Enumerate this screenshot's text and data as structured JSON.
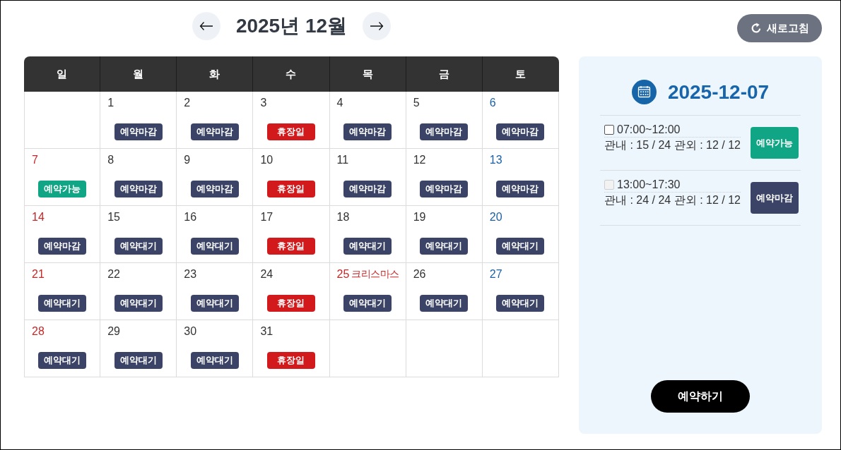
{
  "header": {
    "title": "2025년 12월",
    "refresh_button": "새로고침"
  },
  "calendar": {
    "weekdays": [
      "일",
      "월",
      "화",
      "수",
      "목",
      "금",
      "토"
    ],
    "weeks": [
      [
        {
          "day": "1",
          "kind": "weekday",
          "badge": {
            "label": "예약마감",
            "color": "#3b4466"
          }
        },
        {
          "day": "2",
          "kind": "weekday",
          "badge": {
            "label": "예약마감",
            "color": "#3b4466"
          }
        },
        {
          "day": "3",
          "kind": "weekday",
          "badge": {
            "label": "휴장일",
            "color": "#d2191c"
          }
        },
        {
          "day": "4",
          "kind": "weekday",
          "badge": {
            "label": "예약마감",
            "color": "#3b4466"
          }
        },
        {
          "day": "5",
          "kind": "weekday",
          "badge": {
            "label": "예약마감",
            "color": "#3b4466"
          }
        },
        {
          "day": "6",
          "kind": "saturday",
          "badge": {
            "label": "예약마감",
            "color": "#3b4466"
          }
        }
      ],
      [
        {
          "day": "7",
          "kind": "holiday",
          "badge": {
            "label": "예약가능",
            "color": "#10a584"
          }
        },
        {
          "day": "8",
          "kind": "weekday",
          "badge": {
            "label": "예약마감",
            "color": "#3b4466"
          }
        },
        {
          "day": "9",
          "kind": "weekday",
          "badge": {
            "label": "예약마감",
            "color": "#3b4466"
          }
        },
        {
          "day": "10",
          "kind": "weekday",
          "badge": {
            "label": "휴장일",
            "color": "#d2191c"
          }
        },
        {
          "day": "11",
          "kind": "weekday",
          "badge": {
            "label": "예약마감",
            "color": "#3b4466"
          }
        },
        {
          "day": "12",
          "kind": "weekday",
          "badge": {
            "label": "예약마감",
            "color": "#3b4466"
          }
        },
        {
          "day": "13",
          "kind": "saturday",
          "badge": {
            "label": "예약마감",
            "color": "#3b4466"
          }
        }
      ],
      [
        {
          "day": "14",
          "kind": "holiday",
          "badge": {
            "label": "예약마감",
            "color": "#3b4466"
          }
        },
        {
          "day": "15",
          "kind": "weekday",
          "badge": {
            "label": "예약대기",
            "color": "#3b4466"
          }
        },
        {
          "day": "16",
          "kind": "weekday",
          "badge": {
            "label": "예약대기",
            "color": "#3b4466"
          }
        },
        {
          "day": "17",
          "kind": "weekday",
          "badge": {
            "label": "휴장일",
            "color": "#d2191c"
          }
        },
        {
          "day": "18",
          "kind": "weekday",
          "badge": {
            "label": "예약대기",
            "color": "#3b4466"
          }
        },
        {
          "day": "19",
          "kind": "weekday",
          "badge": {
            "label": "예약대기",
            "color": "#3b4466"
          }
        },
        {
          "day": "20",
          "kind": "saturday",
          "badge": {
            "label": "예약대기",
            "color": "#3b4466"
          }
        }
      ],
      [
        {
          "day": "21",
          "kind": "holiday",
          "badge": {
            "label": "예약대기",
            "color": "#3b4466"
          }
        },
        {
          "day": "22",
          "kind": "weekday",
          "badge": {
            "label": "예약대기",
            "color": "#3b4466"
          }
        },
        {
          "day": "23",
          "kind": "weekday",
          "badge": {
            "label": "예약대기",
            "color": "#3b4466"
          }
        },
        {
          "day": "24",
          "kind": "weekday",
          "badge": {
            "label": "휴장일",
            "color": "#d2191c"
          }
        },
        {
          "day": "25",
          "kind": "holiday",
          "holiday_name": "크리스마스",
          "badge": {
            "label": "예약대기",
            "color": "#3b4466"
          }
        },
        {
          "day": "26",
          "kind": "weekday",
          "badge": {
            "label": "예약대기",
            "color": "#3b4466"
          }
        },
        {
          "day": "27",
          "kind": "saturday",
          "badge": {
            "label": "예약대기",
            "color": "#3b4466"
          }
        }
      ],
      [
        {
          "day": "28",
          "kind": "holiday",
          "badge": {
            "label": "예약대기",
            "color": "#3b4466"
          }
        },
        {
          "day": "29",
          "kind": "weekday",
          "badge": {
            "label": "예약대기",
            "color": "#3b4466"
          }
        },
        {
          "day": "30",
          "kind": "weekday",
          "badge": {
            "label": "예약대기",
            "color": "#3b4466"
          }
        },
        {
          "day": "31",
          "kind": "weekday",
          "badge": {
            "label": "휴장일",
            "color": "#d2191c"
          }
        }
      ]
    ]
  },
  "panel": {
    "date": "2025-12-07",
    "slots": [
      {
        "checked": false,
        "disabled": false,
        "time": "07:00~12:00",
        "capacity": "관내 : 15 / 24 관외 : 12 / 12",
        "status": {
          "label": "예약가능",
          "color": "#10a584"
        }
      },
      {
        "checked": false,
        "disabled": true,
        "time": "13:00~17:30",
        "capacity": "관내 : 24 / 24 관외 : 12 / 12",
        "status": {
          "label": "예약마감",
          "color": "#3b4466"
        }
      }
    ],
    "submit_button": "예약하기"
  }
}
